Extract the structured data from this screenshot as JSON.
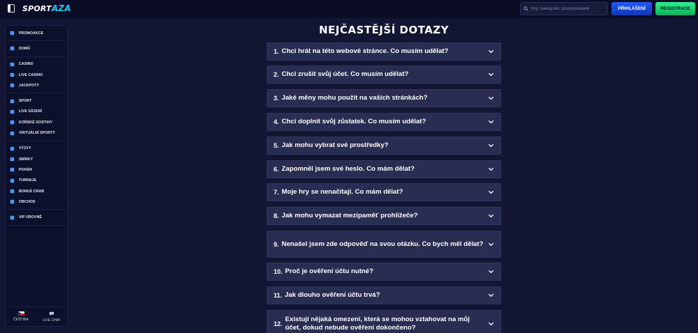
{
  "header": {
    "logo_text": "SPORT",
    "logo_accent": "AZA",
    "search_placeholder": "Hry, kategorie, poskytovatelé",
    "login_label": "PŘIHLÁŠENÍ",
    "register_label": "REGISTRACE"
  },
  "sidebar": {
    "groups": [
      [
        {
          "label": "PROMOAKCE",
          "icon": "gift-icon"
        }
      ],
      [
        {
          "label": "DOMŮ",
          "icon": "home-icon"
        }
      ],
      [
        {
          "label": "CASINO",
          "icon": "slot-icon"
        },
        {
          "label": "LIVE CASINO",
          "icon": "cards-icon"
        },
        {
          "label": "JACKPOTY",
          "icon": "jackpot-icon"
        }
      ],
      [
        {
          "label": "SPORT",
          "icon": "ball-icon"
        },
        {
          "label": "LIVE SÁZENÍ",
          "icon": "live-icon"
        },
        {
          "label": "KOŇSKÉ DOSTIHY",
          "icon": "horse-icon"
        },
        {
          "label": "VIRTUÁLNÍ SPORTY",
          "icon": "virtual-icon"
        }
      ],
      [
        {
          "label": "VÝZVY",
          "icon": "challenge-icon"
        },
        {
          "label": "SBÍRKY",
          "icon": "collection-icon"
        },
        {
          "label": "POHÁR",
          "icon": "trophy-icon"
        },
        {
          "label": "TURNAJE",
          "icon": "tournament-icon"
        },
        {
          "label": "BONUS CRAB",
          "icon": "crab-icon"
        },
        {
          "label": "OBCHOD",
          "icon": "shop-icon"
        }
      ],
      [
        {
          "label": "VIP ÚROVNĚ",
          "icon": "diamond-icon"
        }
      ]
    ],
    "language_label": "ČEŠTINA",
    "chat_label": "LIVE CHAT"
  },
  "main": {
    "title": "NEJČASTĚJŠÍ DOTAZY",
    "faq": [
      {
        "num": "1.",
        "q": "Chci hrát na této webové stránce. Co musím udělat?"
      },
      {
        "num": "2.",
        "q": "Chci zrušit svůj účet. Co musím udělat?"
      },
      {
        "num": "3.",
        "q": "Jaké měny mohu použít na vašich stránkách?"
      },
      {
        "num": "4.",
        "q": "Chci doplnit svůj zůstatek. Co musím udělat?"
      },
      {
        "num": "5.",
        "q": "Jak mohu vybrat své prostředky?"
      },
      {
        "num": "6.",
        "q": "Zapomněl jsem své heslo. Co mám dělat?"
      },
      {
        "num": "7.",
        "q": "Moje hry se nenačítají. Co mám dělat?"
      },
      {
        "num": "8.",
        "q": "Jak mohu vymazat mezipaměť prohlížeče?"
      },
      {
        "num": "9.",
        "q": "Nenašel jsem zde odpověď na svou otázku. Co bych měl dělat?"
      },
      {
        "num": "10.",
        "q": "Proč je ověření účtu nutné?"
      },
      {
        "num": "11.",
        "q": "Jak dlouho ověření účtu trvá?"
      },
      {
        "num": "12.",
        "q": "Existují nějaká omezení, která se mohou vztahovat na můj účet, dokud nebude ověření dokončeno?"
      }
    ]
  },
  "colors": {
    "background": "#131633",
    "header": "#0b0d26",
    "faq_item": "#2a2d52",
    "login": "#1f5cf0",
    "register": "#2ff08a",
    "icon_accent": "#4a9bff"
  }
}
